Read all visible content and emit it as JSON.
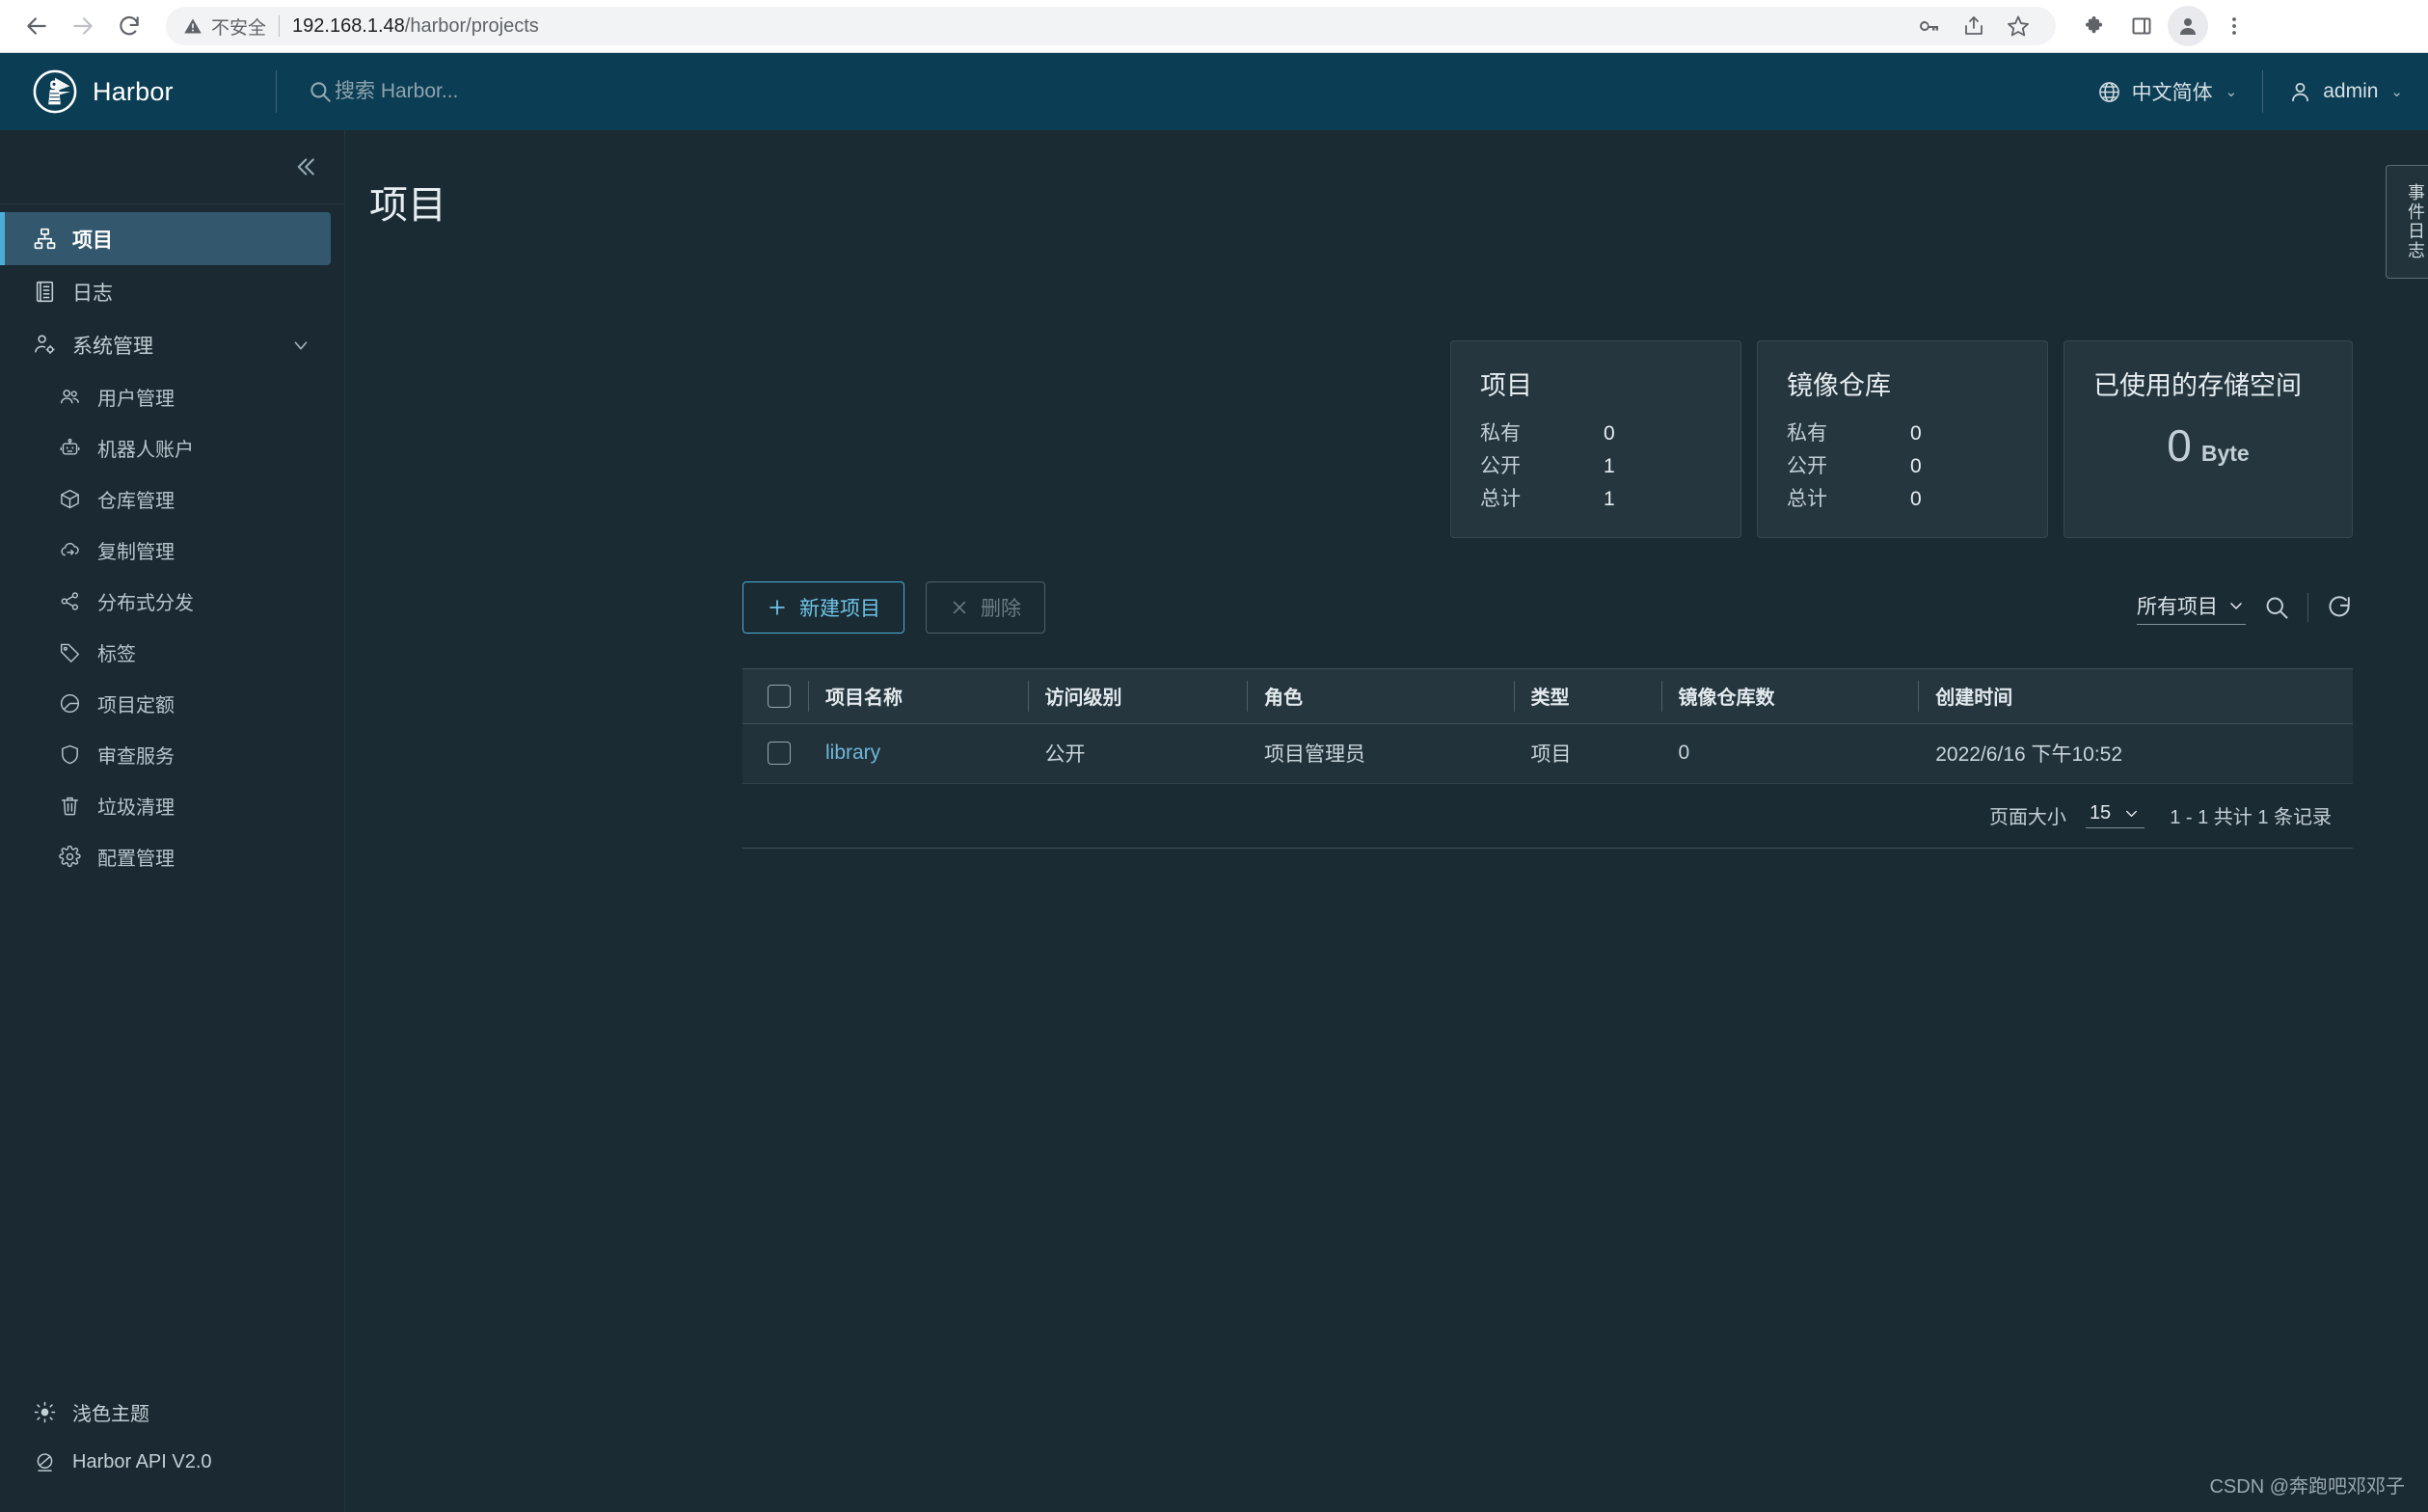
{
  "browser": {
    "back_icon": "arrow-left-icon",
    "forward_icon": "arrow-right-icon",
    "reload_icon": "reload-icon",
    "insecure_label": "不安全",
    "url_host": "192.168.1.48",
    "url_path": "/harbor/projects",
    "url_full": "192.168.1.48/harbor/projects",
    "toolbar_icons": [
      "key-icon",
      "share-icon",
      "bookmark-star-icon",
      "extensions-puzzle-icon",
      "side-panel-icon",
      "profile-avatar-icon",
      "three-dot-menu-icon"
    ]
  },
  "header": {
    "brand": "Harbor",
    "logo_icon": "harbor-lighthouse-logo",
    "search_placeholder": "搜索 Harbor...",
    "search_value": "",
    "language": "中文简体",
    "language_icon": "globe-icon",
    "user": "admin",
    "user_icon": "user-icon"
  },
  "sidebar": {
    "collapse_icon": "double-chevron-left-icon",
    "items": [
      {
        "label": "项目",
        "icon": "projects-hierarchy-icon",
        "active": true
      },
      {
        "label": "日志",
        "icon": "logs-list-icon",
        "active": false
      },
      {
        "label": "系统管理",
        "icon": "administration-user-gear-icon",
        "active": false,
        "expandable": true
      }
    ],
    "sub_items": [
      {
        "label": "用户管理",
        "icon": "users-icon"
      },
      {
        "label": "机器人账户",
        "icon": "robot-icon"
      },
      {
        "label": "仓库管理",
        "icon": "cube-registry-icon"
      },
      {
        "label": "复制管理",
        "icon": "cloud-sync-replication-icon"
      },
      {
        "label": "分布式分发",
        "icon": "share-network-icon"
      },
      {
        "label": "标签",
        "icon": "tag-icon"
      },
      {
        "label": "项目定额",
        "icon": "pie-chart-quota-icon"
      },
      {
        "label": "审查服务",
        "icon": "shield-scan-icon"
      },
      {
        "label": "垃圾清理",
        "icon": "trash-icon"
      },
      {
        "label": "配置管理",
        "icon": "gear-icon"
      }
    ],
    "footer": [
      {
        "label": "浅色主题",
        "icon": "sun-theme-icon"
      },
      {
        "label": "Harbor API V2.0",
        "icon": "api-icon"
      }
    ]
  },
  "main": {
    "page_title": "项目",
    "event_log_tab": "事件日志",
    "watermark": "CSDN @奔跑吧邓邓子",
    "cards": [
      {
        "title": "项目",
        "rows": [
          {
            "label": "私有",
            "value": "0"
          },
          {
            "label": "公开",
            "value": "1"
          },
          {
            "label": "总计",
            "value": "1"
          }
        ]
      },
      {
        "title": "镜像仓库",
        "rows": [
          {
            "label": "私有",
            "value": "0"
          },
          {
            "label": "公开",
            "value": "0"
          },
          {
            "label": "总计",
            "value": "0"
          }
        ]
      }
    ],
    "storage_card": {
      "title": "已使用的存储空间",
      "value": "0",
      "unit": "Byte"
    },
    "toolbar": {
      "new_project_label": "新建项目",
      "new_project_icon": "plus-icon",
      "delete_label": "删除",
      "delete_icon": "close-x-icon",
      "filter_value": "所有项目",
      "filter_icon": "chevron-down-icon",
      "search_icon": "search-icon",
      "refresh_icon": "refresh-icon"
    },
    "table": {
      "columns": [
        "项目名称",
        "访问级别",
        "角色",
        "类型",
        "镜像仓库数",
        "创建时间"
      ],
      "rows": [
        {
          "name": "library",
          "access": "公开",
          "role": "项目管理员",
          "type": "项目",
          "repo_count": "0",
          "created": "2022/6/16 下午10:52"
        }
      ]
    },
    "pagination": {
      "page_size_label": "页面大小",
      "page_size_value": "15",
      "range_label": "1 - 1 共计 1 条记录"
    }
  },
  "colors": {
    "header_bg": "#0b3d54",
    "sidebar_bg": "#1b2a32",
    "content_bg": "#1b2b33",
    "card_bg": "#25363e",
    "accent": "#4aaed9",
    "link": "#6fb6da",
    "active_nav_bg": "#33586e"
  }
}
